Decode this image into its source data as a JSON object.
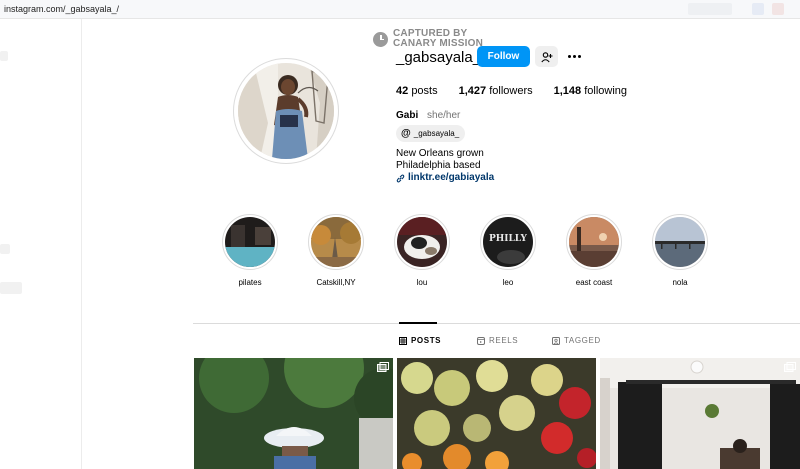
{
  "browser": {
    "url": "instagram.com/_gabsayala_/"
  },
  "watermark": {
    "line1": "CAPTURED BY",
    "line2": "CANARY MISSION"
  },
  "profile": {
    "username": "_gabsayala_",
    "follow_label": "Follow",
    "posts_count": "42",
    "posts_label": "posts",
    "followers_count": "1,427",
    "followers_label": "followers",
    "following_count": "1,148",
    "following_label": "following",
    "display_name": "Gabi",
    "pronouns": "she/her",
    "threads_handle": "_gabsayala_",
    "bio_line1": "New Orleans grown",
    "bio_line2": "Philadelphia based",
    "link": "linktr.ee/gabiayala"
  },
  "highlights": [
    {
      "label": "pilates"
    },
    {
      "label": "Catskill,NY"
    },
    {
      "label": "lou"
    },
    {
      "label": "leo",
      "image_text": "PHILLY"
    },
    {
      "label": "east coast"
    },
    {
      "label": "nola"
    }
  ],
  "tabs": [
    {
      "label": "POSTS",
      "active": true
    },
    {
      "label": "REELS",
      "active": false
    },
    {
      "label": "TAGGED",
      "active": false
    }
  ],
  "colors": {
    "primary_button": "#0095f6",
    "link": "#00376b",
    "muted": "#737373",
    "border": "#dbdbdb"
  }
}
